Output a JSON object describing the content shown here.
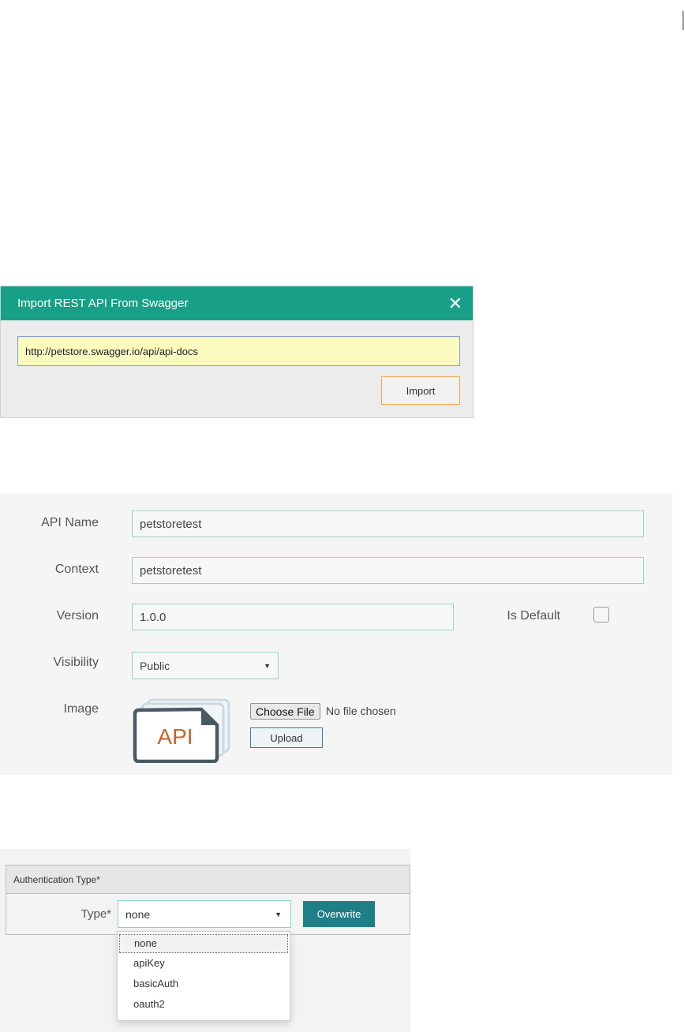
{
  "import_dialog": {
    "title": "Import REST API From Swagger",
    "close_glyph": "✕",
    "url_value": "http://petstore.swagger.io/api/api-docs",
    "import_label": "Import",
    "colors": {
      "header": "#17a087",
      "url_bg": "#fbfbbf",
      "import_border": "#f0a850"
    }
  },
  "api_form": {
    "api_name_label": "API Name",
    "api_name_value": "petstoretest",
    "context_label": "Context",
    "context_value": "petstoretest",
    "version_label": "Version",
    "version_value": "1.0.0",
    "is_default_label": "Is Default",
    "is_default_checked": false,
    "visibility_label": "Visibility",
    "visibility_value": "Public",
    "image_label": "Image",
    "image_thumbnail_text": "API",
    "choose_file_label": "Choose File",
    "no_file_text": "No file chosen",
    "upload_label": "Upload"
  },
  "auth": {
    "section_title": "Authentication Type*",
    "type_label": "Type*",
    "type_value": "none",
    "overwrite_label": "Overwrite",
    "options": [
      "none",
      "apiKey",
      "basicAuth",
      "oauth2"
    ],
    "highlighted_option": "none",
    "colors": {
      "overwrite_bg": "#1f7f86"
    }
  }
}
